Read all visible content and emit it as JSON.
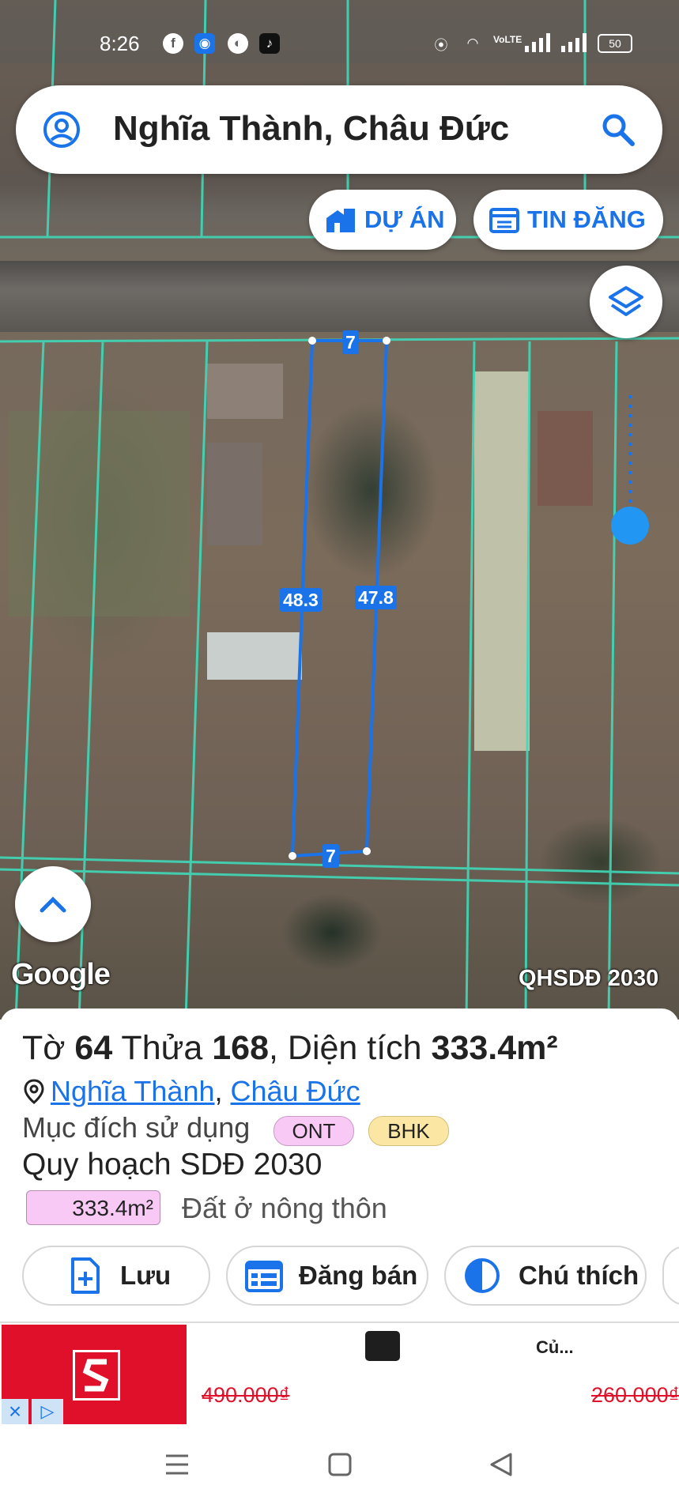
{
  "status_bar": {
    "time": "8:26",
    "network_label": "VoLTE",
    "battery": "50"
  },
  "search": {
    "query": "Nghĩa Thành, Châu Đức"
  },
  "top_pills": {
    "projects": "DỰ ÁN",
    "listings": "TIN ĐĂNG"
  },
  "plot": {
    "top_width": "7",
    "bottom_width": "7",
    "left_length": "48.3",
    "right_length": "47.8"
  },
  "map": {
    "attribution": "Google",
    "layer_name": "QHSDĐ 2030"
  },
  "parcel": {
    "title_prefix": "Tờ ",
    "sheet_number": "64",
    "title_mid": " Thửa ",
    "parcel_number": "168",
    "title_area_prefix": ", Diện tích ",
    "area": "333.4m²",
    "location_ward": "Nghĩa Thành",
    "location_sep": ", ",
    "location_district": "Châu Đức",
    "purpose_label": "Mục đích sử dụng",
    "purpose_tags": [
      "ONT",
      "BHK"
    ],
    "plan_title": "Quy hoạch SDĐ 2030",
    "plan_area": "333.4m²",
    "plan_land_type": "Đất ở nông thôn"
  },
  "actions": {
    "save": "Lưu",
    "sell": "Đăng bán",
    "legend": "Chú thích"
  },
  "ad": {
    "product_title": "Củ...",
    "old_price_1": "490.000₫",
    "old_price_2": "260.000₫"
  },
  "colors": {
    "accent": "#1a73e8",
    "boundary": "#3fd9b8",
    "ont_tag": "#f7c9f4",
    "bhk_tag": "#fbe7a3",
    "ad_red": "#e0102a"
  }
}
